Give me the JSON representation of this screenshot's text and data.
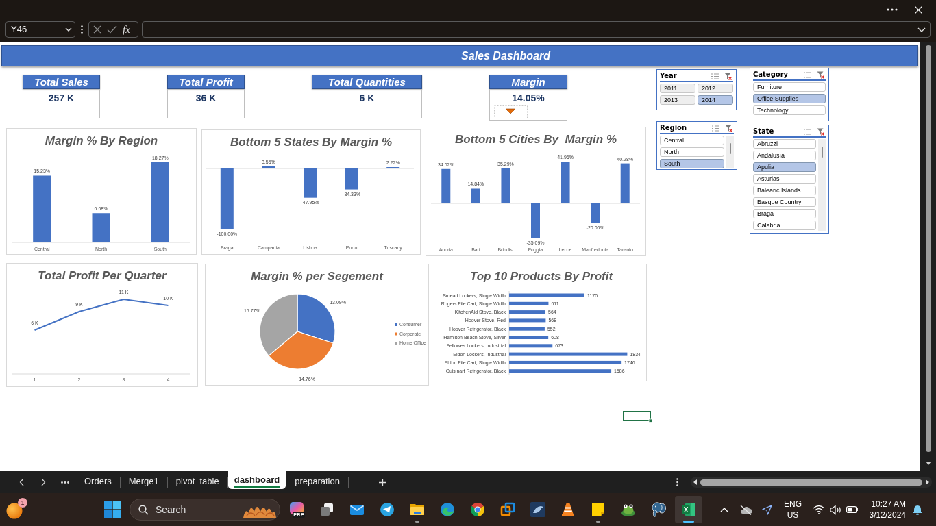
{
  "formula_bar": {
    "name_box": "Y46",
    "function_button": "fx"
  },
  "dashboard": {
    "title": "Sales Dashboard",
    "kpis": [
      {
        "label": "Total Sales",
        "value": "257 K"
      },
      {
        "label": "Total Profit",
        "value": "36 K"
      },
      {
        "label": "Total Quantities",
        "value": "6 K"
      },
      {
        "label": "Margin",
        "value": "14.05%",
        "trend_down": true
      }
    ],
    "charts": [
      {
        "chart_data": {
          "type": "bar",
          "title": "Margin % By Region",
          "categories": [
            "Central",
            "North",
            "South"
          ],
          "values": [
            15.23,
            6.68,
            18.27
          ],
          "color": "#4472c4",
          "value_labels": [
            "15.23%",
            "6.68%",
            "18.27%"
          ]
        }
      },
      {
        "chart_data": {
          "type": "bar",
          "title": "Bottom 5 States By Margin %",
          "categories": [
            "Braga",
            "Campania",
            "Lisboa",
            "Porto",
            "Tuscany"
          ],
          "values": [
            -100,
            3.55,
            -47.95,
            -34.33,
            2.22
          ],
          "color": "#4472c4",
          "value_labels": [
            "-100.00%",
            "3.55%",
            "-47.95%",
            "-34.33%",
            "2.22%"
          ]
        }
      },
      {
        "chart_data": {
          "type": "bar",
          "title": "Bottom 5 Cities By  Margin %",
          "categories": [
            "Andria",
            "Bari",
            "Brindisi",
            "Foggia",
            "Lecce",
            "Manfredonia",
            "Taranto"
          ],
          "values": [
            34.62,
            14.84,
            35.29,
            -35.09,
            41.96,
            -20,
            40.28
          ],
          "color": "#4472c4",
          "value_labels": [
            "34.62%",
            "14.84%",
            "35.29%",
            "-35.09%",
            "41.96%",
            "-20.00%",
            "40.28%"
          ]
        }
      },
      {
        "chart_data": {
          "type": "line",
          "title": "Total Profit Per Quarter",
          "categories": [
            "1",
            "2",
            "3",
            "4"
          ],
          "values": [
            6,
            9,
            11,
            10
          ],
          "color": "#4472c4",
          "value_labels": [
            "6 K",
            "9 K",
            "11 K",
            "10 K"
          ]
        }
      },
      {
        "chart_data": {
          "type": "pie",
          "title": "Margin % per Segement",
          "categories": [
            "Consumer",
            "Corporate",
            "Home Office"
          ],
          "values": [
            13.09,
            14.76,
            15.77
          ],
          "colors": [
            "#4472c4",
            "#ed7d31",
            "#a5a5a5"
          ],
          "value_labels": [
            "13.09%",
            "14.76%",
            "15.77%"
          ],
          "legend": "right"
        }
      },
      {
        "chart_data": {
          "type": "bar",
          "orientation": "horizontal",
          "title": "Top 10 Products By Profit",
          "categories": [
            "Smead Lockers, Single Width",
            "Rogers File Cart, Single Width",
            "KitchenAid Stove, Black",
            "Hoover Stove, Red",
            "Hoover Refrigerator, Black",
            "Hamilton Beach Stove, Silver",
            "Fellowes Lockers, Industrial",
            "Eldon Lockers, Industrial",
            "Eldon File Cart, Single Width",
            "Cuisinart Refrigerator, Black"
          ],
          "values": [
            1170,
            611,
            564,
            568,
            552,
            608,
            673,
            1834,
            1746,
            1586
          ],
          "color": "#4472c4",
          "value_labels": [
            "1170",
            "611",
            "564",
            "568",
            "552",
            "608",
            "673",
            "1834",
            "1746",
            "1586"
          ]
        }
      }
    ],
    "slicers": [
      {
        "title": "Year",
        "kind": "grid",
        "items": [
          {
            "label": "2011",
            "selected": false
          },
          {
            "label": "2012",
            "selected": false
          },
          {
            "label": "2013",
            "selected": false
          },
          {
            "label": "2014",
            "selected": true
          }
        ]
      },
      {
        "title": "Category",
        "kind": "list",
        "items": [
          {
            "label": "Furniture",
            "selected": false
          },
          {
            "label": "Office Supplies",
            "selected": true
          },
          {
            "label": "Technology",
            "selected": false
          }
        ]
      },
      {
        "title": "Region",
        "kind": "scroll_list",
        "items": [
          {
            "label": "Central",
            "selected": false
          },
          {
            "label": "North",
            "selected": false
          },
          {
            "label": "South",
            "selected": true
          }
        ]
      },
      {
        "title": "State",
        "kind": "scroll_list",
        "items": [
          {
            "label": "Abruzzi",
            "selected": false
          },
          {
            "label": "Andalusía",
            "selected": false
          },
          {
            "label": "Apulia",
            "selected": true
          },
          {
            "label": "Asturias",
            "selected": false
          },
          {
            "label": "Balearic Islands",
            "selected": false
          },
          {
            "label": "Basque Country",
            "selected": false
          },
          {
            "label": "Braga",
            "selected": false
          },
          {
            "label": "Calabria",
            "selected": false
          }
        ]
      }
    ]
  },
  "sheet_tabs": [
    {
      "label": "Orders",
      "selected": false
    },
    {
      "label": "Merge1",
      "selected": false
    },
    {
      "label": "pivot_table",
      "selected": false
    },
    {
      "label": "dashboard",
      "selected": true
    },
    {
      "label": "preparation",
      "selected": false
    }
  ],
  "taskbar": {
    "notification_badge": "1",
    "search_box": {
      "label": "Search"
    },
    "apps": [
      {
        "kind": "colorful_tile",
        "badge": "PRE",
        "running": false,
        "active": false
      },
      {
        "kind": "windows_stack",
        "running": false,
        "active": false
      },
      {
        "kind": "envelope",
        "running": false,
        "active": false
      },
      {
        "kind": "paper_plane",
        "running": false,
        "active": false
      },
      {
        "kind": "folder",
        "running": true,
        "active": false
      },
      {
        "kind": "swirl",
        "running": false,
        "active": false
      },
      {
        "kind": "ring_ball",
        "running": false,
        "active": false
      },
      {
        "kind": "cube",
        "running": false,
        "active": false
      },
      {
        "kind": "dolphin",
        "running": false,
        "active": false
      },
      {
        "kind": "cone",
        "running": false,
        "active": false
      },
      {
        "kind": "note",
        "running": true,
        "active": false
      },
      {
        "kind": "frog",
        "running": false,
        "active": false
      },
      {
        "kind": "elephant",
        "running": false,
        "active": false
      },
      {
        "kind": "spreadsheet",
        "letter": "X",
        "running": true,
        "active": true
      }
    ],
    "tray": {
      "language": "ENG",
      "region": "US",
      "time": "10:27 AM",
      "date": "3/12/2024"
    }
  }
}
